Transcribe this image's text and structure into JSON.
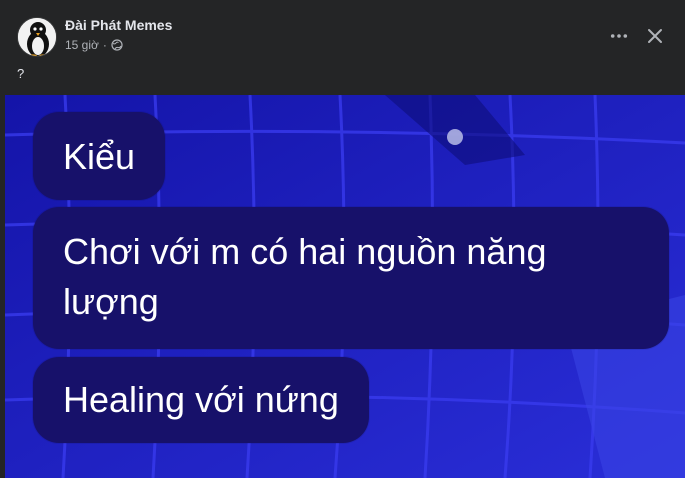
{
  "post": {
    "author": "Đài Phát Memes",
    "time": "15 giờ",
    "separator": "·",
    "caption": "?",
    "icons": {
      "avatar": "penguin-avatar",
      "privacy": "globe-icon",
      "more": "more-horizontal-icon",
      "close": "close-icon"
    }
  },
  "media": {
    "bubbles": [
      "Kiểu",
      "Chơi với m có hai nguồn năng lượng",
      "Healing với nứng"
    ],
    "colors": {
      "background": "#1e22c8",
      "bubble": "#17116a",
      "text": "#ffffff"
    }
  }
}
